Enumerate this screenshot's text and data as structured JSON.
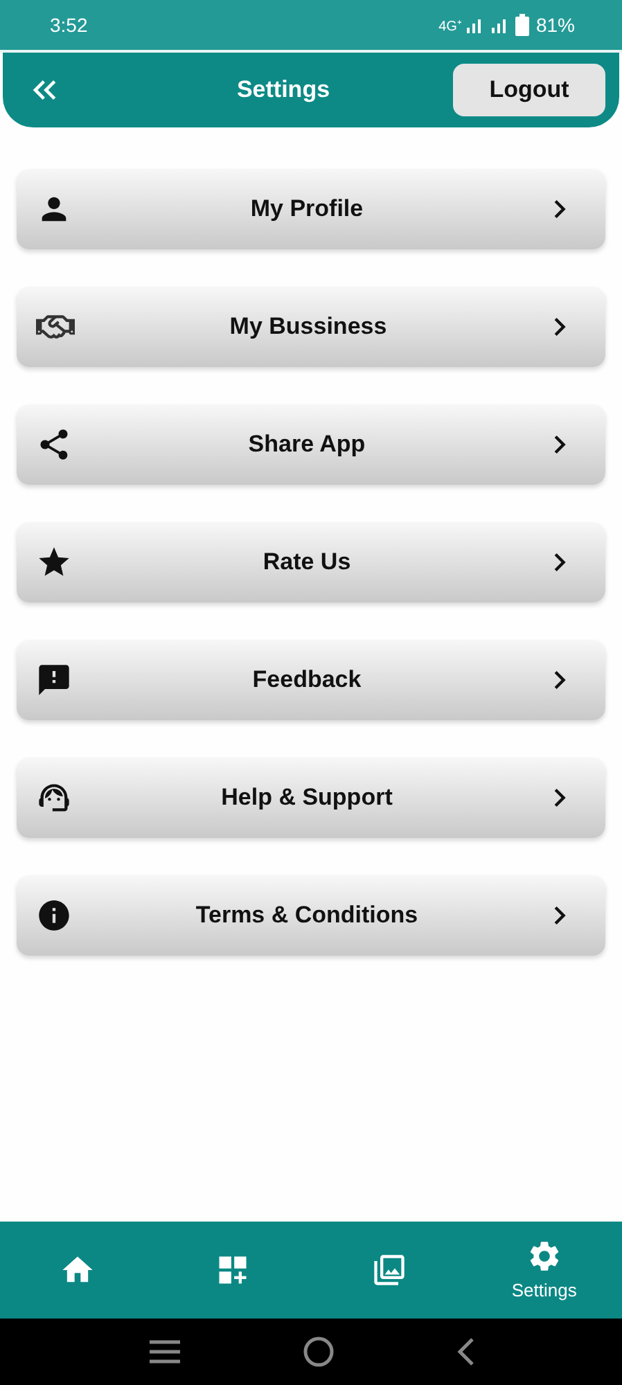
{
  "status_bar": {
    "time": "3:52",
    "network": "4G⁺",
    "battery": "81%"
  },
  "header": {
    "title": "Settings",
    "logout": "Logout"
  },
  "items": [
    {
      "kind": "profile",
      "label": "My Profile"
    },
    {
      "kind": "business",
      "label": "My Bussiness"
    },
    {
      "kind": "share",
      "label": "Share App"
    },
    {
      "kind": "rate",
      "label": "Rate Us"
    },
    {
      "kind": "feedback",
      "label": "Feedback"
    },
    {
      "kind": "support",
      "label": "Help & Support"
    },
    {
      "kind": "terms",
      "label": "Terms & Conditions"
    }
  ],
  "bottom_nav": [
    {
      "kind": "home",
      "selected": false
    },
    {
      "kind": "add-widget",
      "selected": false
    },
    {
      "kind": "gallery",
      "selected": false
    },
    {
      "kind": "settings",
      "selected": true,
      "label": "Settings"
    }
  ]
}
